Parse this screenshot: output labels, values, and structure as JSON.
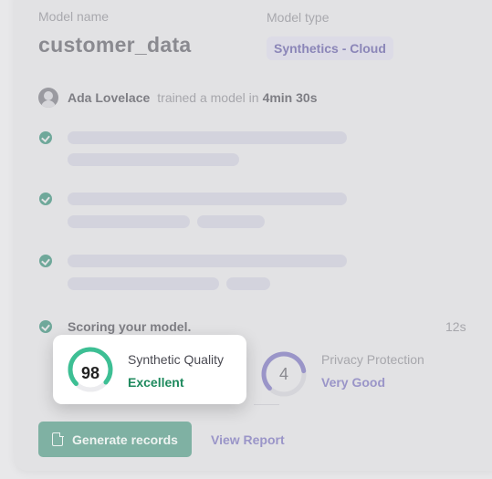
{
  "header": {
    "model_name_label": "Model name",
    "model_name": "customer_data",
    "model_type_label": "Model type",
    "model_type": "Synthetics - Cloud"
  },
  "training": {
    "user": "Ada Lovelace",
    "text": "trained a model in",
    "duration": "4min 30s"
  },
  "steps": [
    {
      "status": "done"
    },
    {
      "status": "done"
    },
    {
      "status": "done"
    }
  ],
  "scoring": {
    "label": "Scoring your model.",
    "time": "12s"
  },
  "quality": {
    "score": "98",
    "title": "Synthetic Quality",
    "grade": "Excellent",
    "fraction": 0.98,
    "color": "#3dbf94"
  },
  "privacy": {
    "score": "4",
    "title": "Privacy Protection",
    "grade": "Very Good",
    "fraction": 0.8,
    "color": "#9a95c8"
  },
  "actions": {
    "generate_label": "Generate records",
    "view_label": "View Report"
  }
}
